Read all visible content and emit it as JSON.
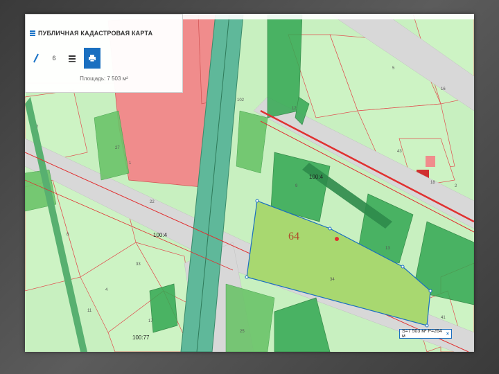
{
  "app": {
    "title": "ПУБЛИЧНАЯ КАДАСТРОВАЯ КАРТА",
    "area_label": "Площадь: 7 503 м²",
    "tool_count": "6"
  },
  "map": {
    "parcel_number": "64",
    "measurement": "S=7 503 м² P=264 м",
    "measurement_close": "×",
    "street_labels": [
      "100:4",
      "100:4",
      "100:77"
    ],
    "parcel_labels": [
      "102",
      "5",
      "8",
      "33",
      "27",
      "12",
      "7",
      "9",
      "43",
      "13",
      "22",
      "11",
      "17",
      "25",
      "41",
      "2",
      "18",
      "4",
      "16",
      "34",
      "1"
    ],
    "colors": {
      "background": "#c8f0c0",
      "building_red": "#f08080",
      "dark_green": "#2e9e44",
      "medium_green": "#66c060",
      "selected_parcel": "#a8d870",
      "road": "#d8d8d8",
      "railway": "#5fb89a",
      "boundary_red": "#e03030",
      "selection_blue": "#1a6fc0"
    }
  },
  "icons": [
    "menu-icon",
    "ruler-icon",
    "layers-icon",
    "print-icon"
  ]
}
